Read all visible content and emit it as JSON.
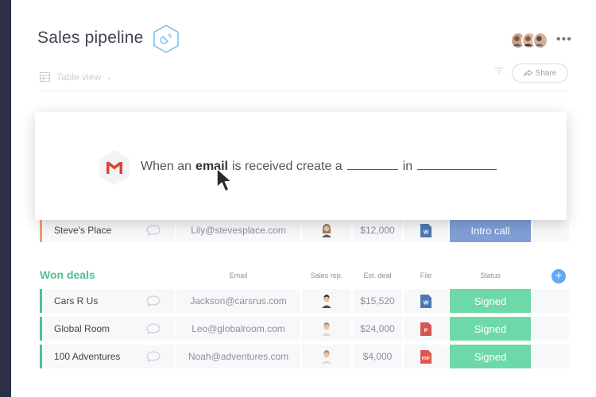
{
  "board": {
    "title": "Sales pipeline",
    "view_label": "Table view",
    "share_label": "Share"
  },
  "popup": {
    "prefix": "When an",
    "trigger": "email",
    "middle": "is received create a",
    "joiner": "in"
  },
  "top_row": {
    "name": "Steve's Place",
    "email": "Lily@stevesplace.com",
    "deal": "$12,000",
    "file_icon": "word-file-icon",
    "status": "Intro call"
  },
  "won_deals": {
    "title": "Won deals",
    "columns": {
      "email": "Email",
      "sales_rep": "Sales rep.",
      "est_deal": "Est. deal",
      "file": "File",
      "status": "Status"
    },
    "rows": [
      {
        "name": "Cars R Us",
        "email": "Jackson@carsrus.com",
        "deal": "$15,520",
        "file_icon": "word-file-icon",
        "status": "Signed"
      },
      {
        "name": "Global Room",
        "email": "Leo@globalroom.com",
        "deal": "$24,000",
        "file_icon": "powerpoint-file-icon",
        "status": "Signed"
      },
      {
        "name": "100 Adventures",
        "email": "Noah@adventures.com",
        "deal": "$4,000",
        "file_icon": "pdf-file-icon",
        "status": "Signed"
      }
    ]
  },
  "colors": {
    "sidebar": "#2b3047",
    "won_green": "#4fc08d",
    "signed": "#6ed9a8",
    "intro_call": "#7e9fd6",
    "add_blue": "#63a9f1",
    "accent_orange": "#f39b6b"
  }
}
